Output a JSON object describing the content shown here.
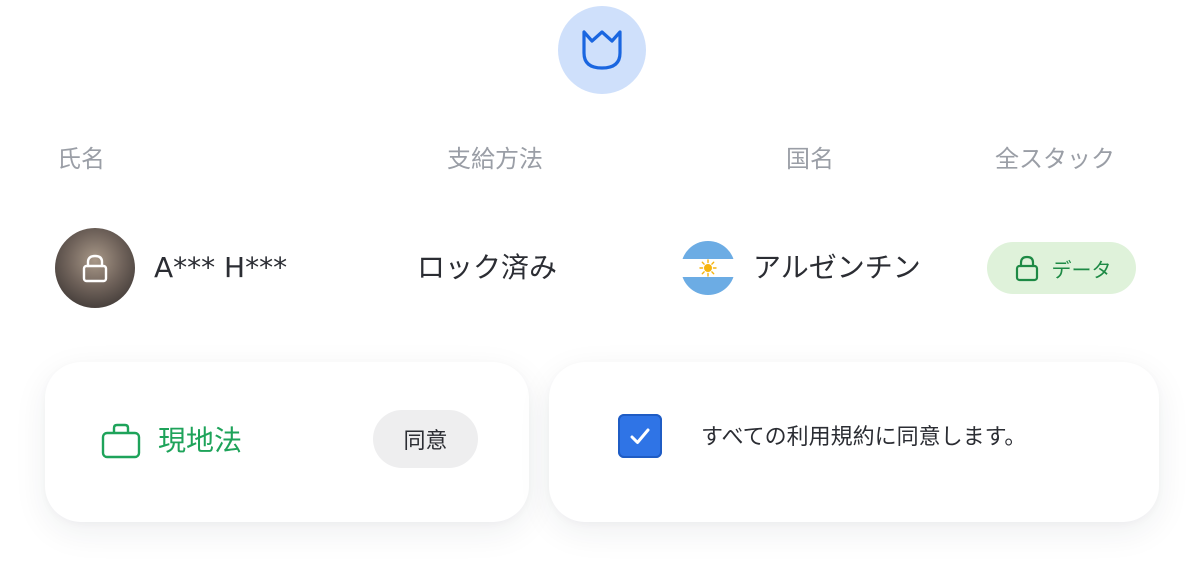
{
  "header": {
    "columns": [
      "氏名",
      "支給方法",
      "国名",
      "全スタック"
    ]
  },
  "row": {
    "name": "A*** H***",
    "payment_method": "ロック済み",
    "country": "アルゼンチン",
    "stack_badge": "データ"
  },
  "local_law_card": {
    "label": "現地法",
    "button": "同意"
  },
  "terms_card": {
    "checked": true,
    "text": "すべての利用規約に同意します。"
  },
  "icons": {
    "top_badge": "shield-icon",
    "avatar_overlay": "lock-icon",
    "flag": "argentina-flag-icon",
    "pill": "lock-icon",
    "local_law": "briefcase-icon",
    "checkbox": "checkmark-icon"
  },
  "colors": {
    "badge_bg": "#cfe0fb",
    "shield_stroke": "#1a66e0",
    "green": "#1ea35a",
    "pill_bg": "#dff2da",
    "checkbox_blue": "#2f74e6",
    "header_gray": "#9a9ea6"
  }
}
